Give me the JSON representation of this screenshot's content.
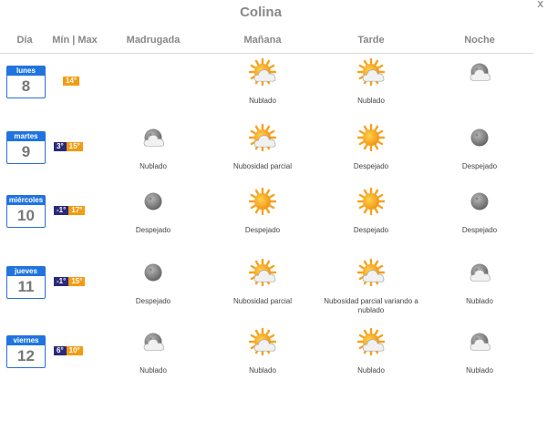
{
  "location": "Colina",
  "close_label": "x",
  "headers": {
    "day": "Día",
    "minmax": "Mín | Max",
    "madrugada": "Madrugada",
    "manana": "Mañana",
    "tarde": "Tarde",
    "noche": "Noche"
  },
  "days": [
    {
      "weekday": "lunes",
      "date": "8",
      "min": "",
      "max": "14°",
      "madrugada": null,
      "manana": {
        "icon": "partly-cloudy-icon",
        "label": "Nublado"
      },
      "tarde": {
        "icon": "partly-cloudy-icon",
        "label": "Nublado"
      },
      "noche": {
        "icon": "night-cloudy-icon",
        "label": ""
      }
    },
    {
      "weekday": "martes",
      "date": "9",
      "min": "3°",
      "max": "15°",
      "madrugada": {
        "icon": "night-cloudy-icon",
        "label": "Nublado"
      },
      "manana": {
        "icon": "partly-cloudy-icon",
        "label": "Nubosidad parcial"
      },
      "tarde": {
        "icon": "sun-icon",
        "label": "Despejado"
      },
      "noche": {
        "icon": "moon-icon",
        "label": "Despejado"
      }
    },
    {
      "weekday": "miércoles",
      "date": "10",
      "min": "-1°",
      "max": "17°",
      "madrugada": {
        "icon": "moon-icon",
        "label": "Despejado"
      },
      "manana": {
        "icon": "sun-icon",
        "label": "Despejado"
      },
      "tarde": {
        "icon": "sun-icon",
        "label": "Despejado"
      },
      "noche": {
        "icon": "moon-icon",
        "label": "Despejado"
      }
    },
    {
      "weekday": "jueves",
      "date": "11",
      "min": "-1°",
      "max": "15°",
      "madrugada": {
        "icon": "moon-icon",
        "label": "Despejado"
      },
      "manana": {
        "icon": "partly-cloudy-icon",
        "label": "Nubosidad parcial"
      },
      "tarde": {
        "icon": "partly-cloudy-icon",
        "label": "Nubosidad parcial variando a nublado"
      },
      "noche": {
        "icon": "night-cloudy-icon",
        "label": "Nublado"
      }
    },
    {
      "weekday": "viernes",
      "date": "12",
      "min": "6°",
      "max": "10°",
      "madrugada": {
        "icon": "night-cloudy-icon",
        "label": "Nublado"
      },
      "manana": {
        "icon": "partly-cloudy-icon",
        "label": "Nublado"
      },
      "tarde": {
        "icon": "partly-cloudy-icon",
        "label": "Nublado"
      },
      "noche": {
        "icon": "night-cloudy-icon",
        "label": "Nublado"
      }
    }
  ]
}
